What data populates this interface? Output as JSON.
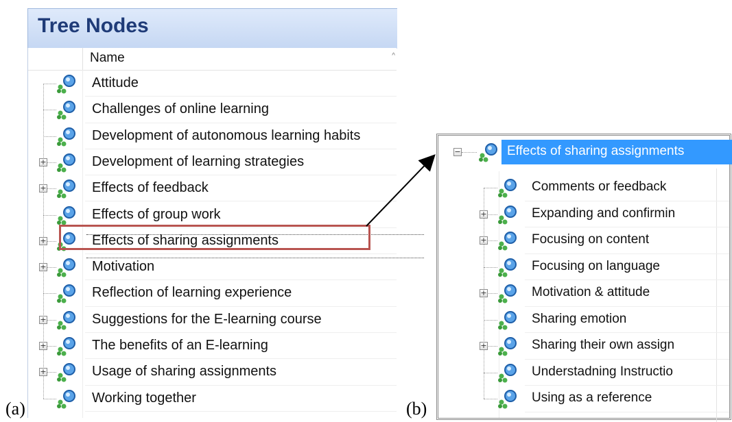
{
  "captions": {
    "a": "(a)",
    "b": "(b)"
  },
  "panel_a": {
    "title": "Tree Nodes",
    "column_header": "Name",
    "sort_indicator": "^",
    "rows": [
      {
        "label": "Attitude",
        "expandable": false
      },
      {
        "label": "Challenges of online learning",
        "expandable": false
      },
      {
        "label": "Development of autonomous learning habits",
        "expandable": false
      },
      {
        "label": "Development of learning strategies",
        "expandable": true
      },
      {
        "label": "Effects of feedback",
        "expandable": true
      },
      {
        "label": "Effects of group work",
        "expandable": false
      },
      {
        "label": "Effects of sharing assignments",
        "expandable": true,
        "highlighted": true
      },
      {
        "label": "Motivation",
        "expandable": true
      },
      {
        "label": "Reflection of learning experience",
        "expandable": false
      },
      {
        "label": "Suggestions for the E-learning course",
        "expandable": true
      },
      {
        "label": "The benefits of an E-learning",
        "expandable": true
      },
      {
        "label": "Usage of sharing assignments",
        "expandable": true
      },
      {
        "label": "Working together",
        "expandable": false
      }
    ]
  },
  "panel_b": {
    "parent": {
      "label": "Effects of sharing assignments",
      "expanded": true
    },
    "children": [
      {
        "label": "Comments or feedback",
        "expandable": false
      },
      {
        "label": "Expanding and confirmin",
        "expandable": true
      },
      {
        "label": "Focusing on content",
        "expandable": true
      },
      {
        "label": "Focusing on language",
        "expandable": false
      },
      {
        "label": "Motivation & attitude",
        "expandable": true
      },
      {
        "label": "Sharing emotion",
        "expandable": false
      },
      {
        "label": "Sharing their own assign",
        "expandable": true
      },
      {
        "label": "Understadning Instructio",
        "expandable": false
      },
      {
        "label": "Using as a reference",
        "expandable": false
      }
    ]
  },
  "icons": {
    "node": "node-cluster-icon",
    "expand": "plus-box-icon",
    "collapse": "minus-box-icon"
  },
  "colors": {
    "header_bg": "#c5d7f3",
    "title_text": "#1f3b78",
    "highlight_box": "#b85450",
    "selection_bg": "#3399ff"
  }
}
